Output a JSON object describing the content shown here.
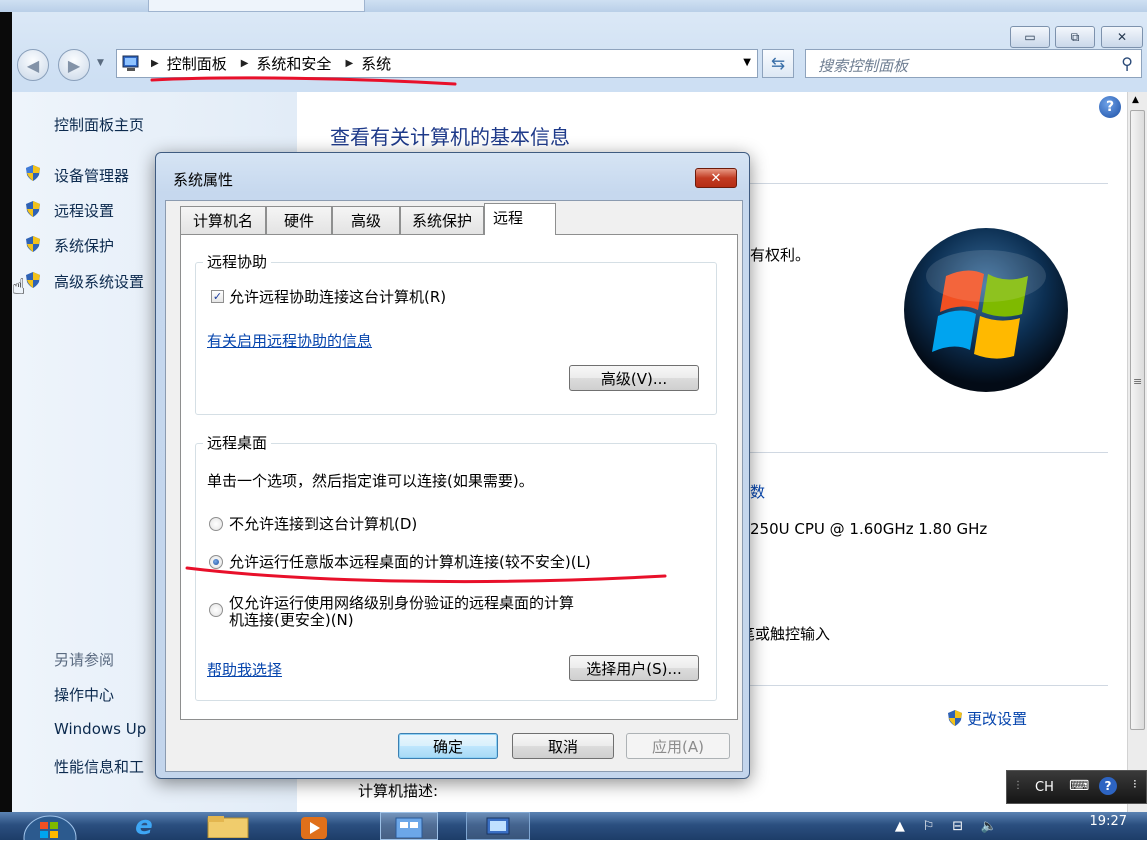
{
  "window": {
    "minimize_glyph": "▭",
    "restore_glyph": "⧉",
    "close_glyph": "✕"
  },
  "address_bar": {
    "crumbs": [
      "控制面板",
      "系统和安全",
      "系统"
    ],
    "search_placeholder": "搜索控制面板"
  },
  "left_pane": {
    "home": "控制面板主页",
    "items": [
      "设备管理器",
      "远程设置",
      "系统保护",
      "高级系统设置"
    ],
    "see_also_title": "另请参阅",
    "see_also": [
      "操作中心",
      "Windows Up",
      "性能信息和工"
    ]
  },
  "main": {
    "title": "查看有关计算机的基本信息",
    "fragment_rights": "有权利。",
    "fragment_index": "数",
    "fragment_cpu": "250U CPU @ 1.60GHz   1.80 GHz",
    "fragment_touch": "笔或触控输入",
    "change_settings": "更改设置",
    "computer_description": "计算机描述:"
  },
  "dialog": {
    "title": "系统属性",
    "close_glyph": "✕",
    "tabs": [
      "计算机名",
      "硬件",
      "高级",
      "系统保护",
      "远程"
    ],
    "remote_assistance": {
      "label": "远程协助",
      "allow_checkbox": "允许远程协助连接这台计算机(R)",
      "info_link": "有关启用远程协助的信息",
      "advanced_button": "高级(V)..."
    },
    "remote_desktop": {
      "label": "远程桌面",
      "instruction": "单击一个选项，然后指定谁可以连接(如果需要)。",
      "option_none": "不允许连接到这台计算机(D)",
      "option_any": "允许运行任意版本远程桌面的计算机连接(较不安全)(L)",
      "option_nla_line1": "仅允许运行使用网络级别身份验证的远程桌面的计算",
      "option_nla_line2": "机连接(更安全)(N)",
      "help_link": "帮助我选择",
      "select_users_button": "选择用户(S)..."
    },
    "ok_button": "确定",
    "cancel_button": "取消",
    "apply_button": "应用(A)"
  },
  "taskbar": {
    "language": "CH",
    "time": "19:27"
  },
  "colors": {
    "annotation_red": "#e8102a",
    "link_blue": "#0645ad"
  }
}
